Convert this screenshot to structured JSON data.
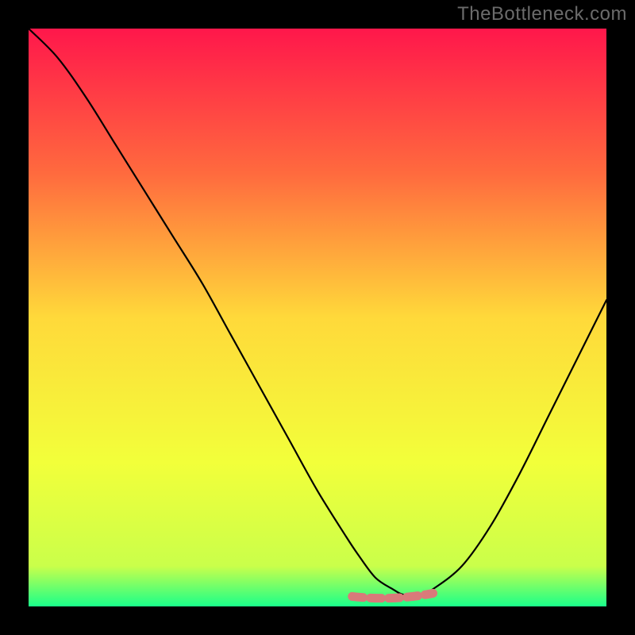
{
  "watermark": "TheBottleneck.com",
  "gradient": {
    "top": "#ff174b",
    "q1": "#ff6a3e",
    "mid": "#ffd93a",
    "q3": "#f2ff3a",
    "near_bottom": "#caff4a",
    "bottom": "#1aff8a"
  },
  "curve_color": "#000000",
  "marker_color": "#d97a7a",
  "chart_data": {
    "type": "line",
    "title": "",
    "xlabel": "",
    "ylabel": "",
    "xlim": [
      0,
      100
    ],
    "ylim": [
      0,
      100
    ],
    "series": [
      {
        "name": "curve",
        "x": [
          0,
          5,
          10,
          15,
          20,
          25,
          30,
          35,
          40,
          45,
          50,
          55,
          57,
          60,
          63,
          65,
          68,
          70,
          75,
          80,
          85,
          90,
          95,
          100
        ],
        "y": [
          100,
          95,
          88,
          80,
          72,
          64,
          56,
          47,
          38,
          29,
          20,
          12,
          9,
          5,
          3,
          2,
          2,
          3,
          7,
          14,
          23,
          33,
          43,
          53
        ]
      }
    ],
    "markers": {
      "name": "flat-region",
      "x_start": 56,
      "x_end": 70,
      "y": 2
    }
  }
}
